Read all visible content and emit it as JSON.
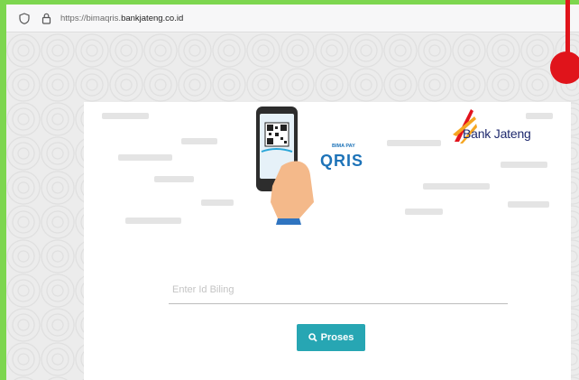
{
  "browser": {
    "url_prefix": "https://bimaqris.",
    "url_domain": "bankjateng.co.id",
    "shield_icon": "shield-icon",
    "lock_icon": "lock-icon"
  },
  "brand": {
    "bank_name": "Bank Jateng",
    "product_small": "BIMA PAY",
    "product_big": "QRIS"
  },
  "form": {
    "billing_placeholder": "Enter Id Biling",
    "billing_value": "",
    "submit_label": "Proses",
    "submit_icon": "search-icon"
  },
  "colors": {
    "outer_border": "#7dd64f",
    "button": "#27a6b3",
    "bank_blue": "#1f2a6e",
    "qris_blue": "#1d73b8",
    "marker_red": "#e0141b"
  }
}
